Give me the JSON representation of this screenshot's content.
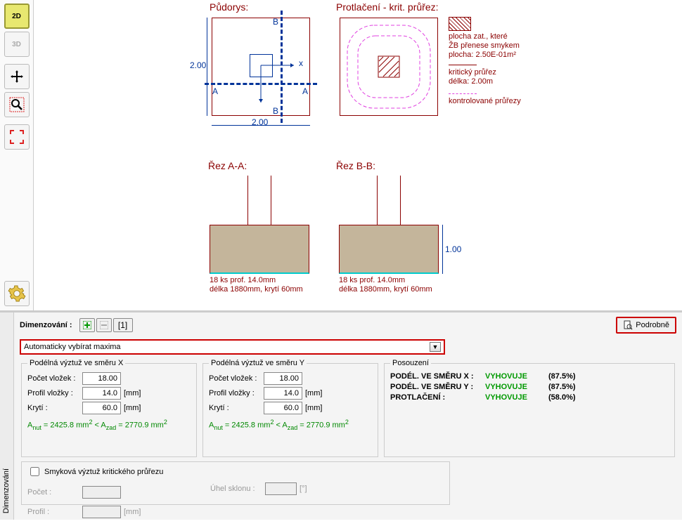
{
  "toolbar": {
    "btn2d": "2D",
    "btn3d": "3D"
  },
  "diagrams": {
    "plan_title": "Půdorys:",
    "plan_dim_v": "2.00",
    "plan_dim_h": "2.00",
    "labelA": "A",
    "labelB": "B",
    "axis_x": "x",
    "punch_title": "Protlačení - krit. průřez:",
    "punch_info1": "plocha zat., které",
    "punch_info2": "ŽB přenese smykem",
    "punch_info3": "plocha: 2.50E-01m²",
    "punch_info4": "kritický průřez",
    "punch_info5": "délka: 2.00m",
    "punch_info6": "kontrolované průřezy",
    "sectionA_title": "Řez A-A:",
    "sectionB_title": "Řez B-B:",
    "section_dim": "1.00",
    "rebarA_line1": "18 ks prof. 14.0mm",
    "rebarA_line2": "délka 1880mm, krytí 60mm",
    "rebarB_line1": "18 ks prof. 14.0mm",
    "rebarB_line2": "délka 1880mm, krytí 60mm"
  },
  "panel": {
    "side_tab": "Dimenzování",
    "title": "Dimenzování :",
    "btn_count": "[1]",
    "podrobne": "Podrobně",
    "dropdown": "Automaticky vybírat maxima"
  },
  "groupX": {
    "legend": "Podélná výztuž ve směru X",
    "count_label": "Počet vložek :",
    "count_value": "18.00",
    "profile_label": "Profil vložky :",
    "profile_value": "14.0",
    "profile_unit": "[mm]",
    "cover_label": "Krytí :",
    "cover_value": "60.0",
    "cover_unit": "[mm]",
    "formula_pre": "A",
    "formula_sub1": "nut",
    "formula_mid1": " = 2425.8 mm",
    "formula_lt": " < A",
    "formula_sub2": "zad",
    "formula_mid2": " = 2770.9 mm"
  },
  "groupY": {
    "legend": "Podélná výztuž ve směru Y",
    "count_label": "Počet vložek :",
    "count_value": "18.00",
    "profile_label": "Profil vložky :",
    "profile_value": "14.0",
    "profile_unit": "[mm]",
    "cover_label": "Krytí :",
    "cover_value": "60.0",
    "cover_unit": "[mm]"
  },
  "result": {
    "legend": "Posouzení",
    "r1_label": "PODÉL. VE SMĚRU X :",
    "r1_status": "VYHOVUJE",
    "r1_pct": "(87.5%)",
    "r2_label": "PODÉL. VE SMĚRU Y :",
    "r2_status": "VYHOVUJE",
    "r2_pct": "(87.5%)",
    "r3_label": "PROTLAČENÍ :",
    "r3_status": "VYHOVUJE",
    "r3_pct": "(58.0%)"
  },
  "shear": {
    "legend": "",
    "checkbox_label": "Smyková výztuž kritického průřezu",
    "count_label": "Počet :",
    "profile_label": "Profil :",
    "profile_unit": "[mm]",
    "angle_label": "Úhel sklonu :",
    "angle_unit": "[°]"
  }
}
